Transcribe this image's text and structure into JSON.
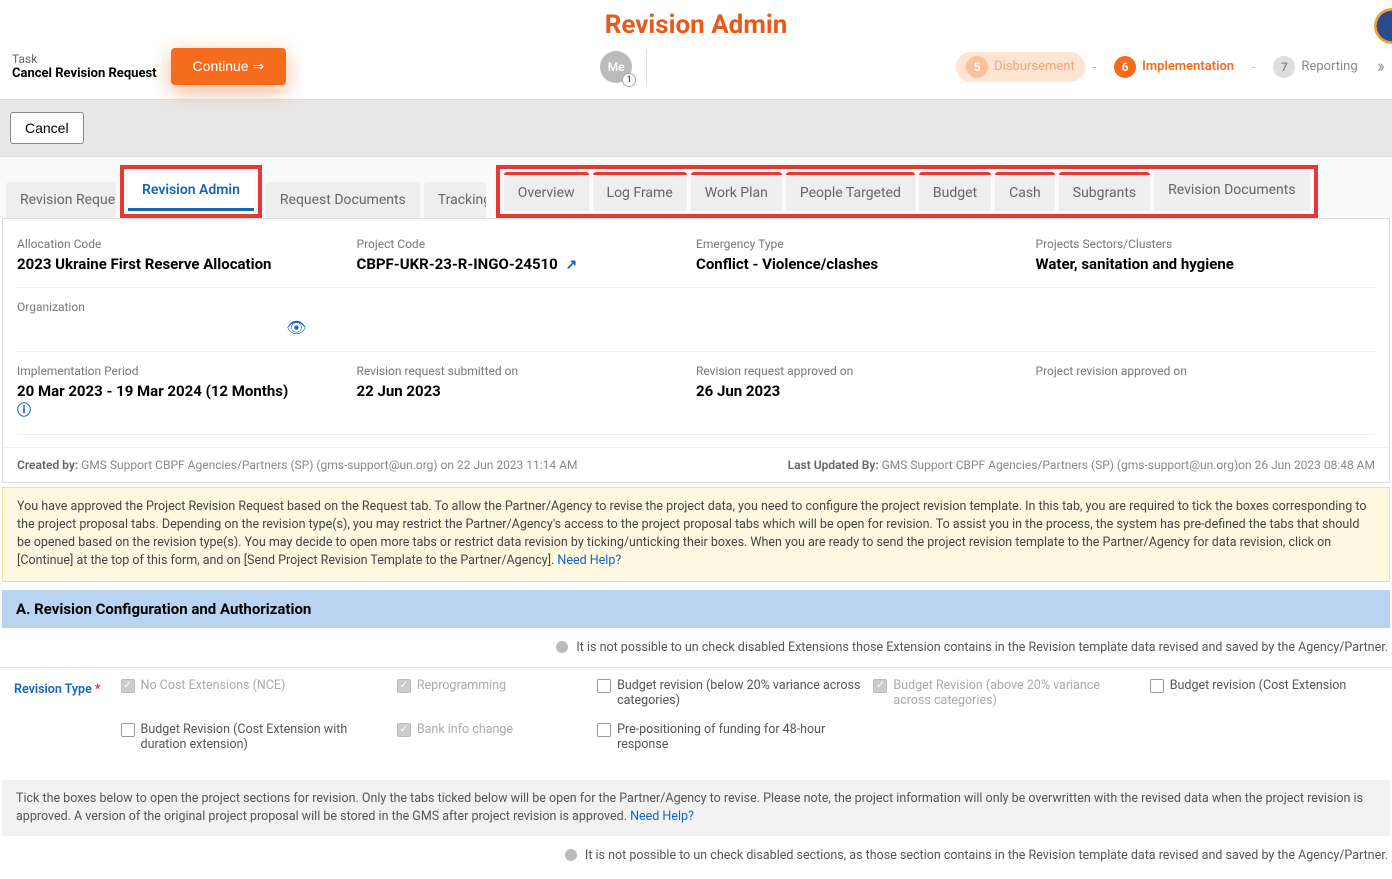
{
  "page_title": "Revision Admin",
  "task": {
    "label": "Task",
    "name": "Cancel Revision Request"
  },
  "continue_btn": "Continue ⇒",
  "me": {
    "label": "Me",
    "badge": "1"
  },
  "stepper": {
    "s5": {
      "num": "5",
      "label": "Disbursement"
    },
    "s6": {
      "num": "6",
      "label": "Implementation"
    },
    "s7": {
      "num": "7",
      "label": "Reporting"
    }
  },
  "cancel_btn": "Cancel",
  "tabs_left": {
    "t1": "Revision Request",
    "t2": "Revision Admin",
    "t3": "Request Documents",
    "t4": "Tracking"
  },
  "tabs_right": {
    "r1": "Overview",
    "r2": "Log Frame",
    "r3": "Work Plan",
    "r4": "People Targeted",
    "r5": "Budget",
    "r6": "Cash",
    "r7": "Subgrants",
    "r8": "Revision Documents"
  },
  "info": {
    "alloc_code": {
      "label": "Allocation Code",
      "value": "2023 Ukraine First Reserve Allocation"
    },
    "project_code": {
      "label": "Project Code",
      "value": "CBPF-UKR-23-R-INGO-24510"
    },
    "emergency": {
      "label": "Emergency Type",
      "value": "Conflict - Violence/clashes"
    },
    "sectors": {
      "label": "Projects Sectors/Clusters",
      "value": "Water, sanitation and hygiene"
    },
    "org": {
      "label": "Organization",
      "value": ""
    },
    "impl_period": {
      "label": "Implementation Period",
      "value": "20 Mar 2023 - 19 Mar 2024 (12 Months)"
    },
    "rev_submitted": {
      "label": "Revision request submitted on",
      "value": "22 Jun 2023"
    },
    "rev_approved": {
      "label": "Revision request approved on",
      "value": "26 Jun 2023"
    },
    "proj_rev_approved": {
      "label": "Project revision approved on",
      "value": ""
    }
  },
  "meta": {
    "created_label": "Created by:",
    "created_value": "GMS Support CBPF Agencies/Partners (SP) (gms-support@un.org) on 22 Jun 2023 11:14 AM",
    "updated_label": "Last Updated By:",
    "updated_value": "GMS Support CBPF Agencies/Partners (SP) (gms-support@un.org)on 26 Jun 2023 08:48 AM"
  },
  "notice1_text": "You have approved the Project Revision Request based on the Request tab. To allow the Partner/Agency to revise the project data, you need to configure the project revision template. In this tab, you are required to tick the boxes corresponding to the project proposal tabs. Depending on the revision type(s), you may restrict the Partner/Agency's access to the project proposal tabs which will be open for revision. To assist you in the process, the system has pre-defined the tabs that should be opened based on the revision type(s). You may decide to open more tabs or restrict data revision by ticking/unticking their boxes. When you are ready to send the project revision template to the Partner/Agency for data revision, click on [Continue] at the top of this form, and on [Send Project Revision Template to the Partner/Agency].",
  "need_help": "Need Help?",
  "section_a": "A. Revision Configuration and Authorization",
  "hint1": "It is not possible to un check disabled Extensions those Extension contains in the Revision template data revised and saved by the Agency/Partner.",
  "rev_type_label": "Revision Type",
  "checks": {
    "c1": "No Cost Extensions (NCE)",
    "c2": "Reprogramming",
    "c3": "Budget revision (below 20% variance across categories)",
    "c4": "Budget Revision (above 20% variance across categories)",
    "c5": "Budget revision (Cost Extension",
    "c6": "Budget Revision (Cost Extension with duration extension)",
    "c7": "Bank info change",
    "c8": "Pre-positioning of funding for 48-hour response"
  },
  "notice2_text": "Tick the boxes below to open the project sections for revision. Only the tabs ticked below will be open for the Partner/Agency to revise. Please note, the project information will only be overwritten with the revised data when the project revision is approved. A version of the original project proposal will be stored in the GMS after project revision is approved.",
  "hint2": "It is not possible to un check disabled sections, as those section contains in the Revision template data revised and saved by the Agency/Partner."
}
